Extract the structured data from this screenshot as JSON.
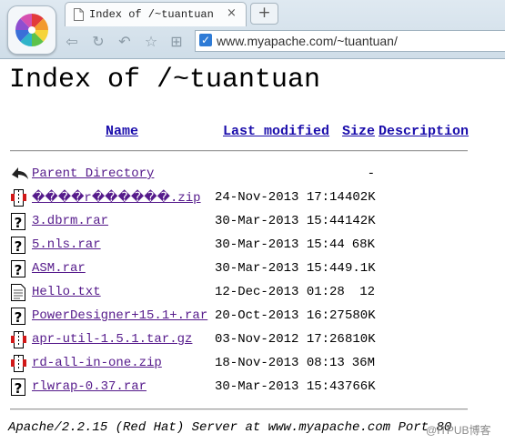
{
  "browser": {
    "tab_title": "Index of /~tuantuan",
    "tab_close": "×",
    "new_tab": "+",
    "url": "www.myapache.com/~tuantuan/"
  },
  "page": {
    "heading": "Index of /~tuantuan",
    "columns": {
      "name": "Name",
      "last_modified": "Last modified",
      "size": "Size",
      "description": "Description"
    },
    "parent": {
      "label": "Parent Directory",
      "size": "-"
    },
    "files": [
      {
        "name": "����r������.zip",
        "date": "24-Nov-2013 17:14",
        "size": "402K",
        "icon": "compressed-icon"
      },
      {
        "name": "3.dbrm.rar",
        "date": "30-Mar-2013 15:44",
        "size": "142K",
        "icon": "unknown-icon"
      },
      {
        "name": "5.nls.rar",
        "date": "30-Mar-2013 15:44",
        "size": "68K",
        "icon": "unknown-icon"
      },
      {
        "name": "ASM.rar",
        "date": "30-Mar-2013 15:44",
        "size": "9.1K",
        "icon": "unknown-icon"
      },
      {
        "name": "Hello.txt",
        "date": "12-Dec-2013 01:28",
        "size": "12",
        "icon": "text-file-icon"
      },
      {
        "name": "PowerDesigner+15.1+.rar",
        "date": "20-Oct-2013 16:27",
        "size": "580K",
        "icon": "unknown-icon"
      },
      {
        "name": "apr-util-1.5.1.tar.gz",
        "date": "03-Nov-2012 17:26",
        "size": "810K",
        "icon": "compressed-icon"
      },
      {
        "name": "rd-all-in-one.zip",
        "date": "18-Nov-2013 08:13",
        "size": "36M",
        "icon": "compressed-icon"
      },
      {
        "name": "rlwrap-0.37.rar",
        "date": "30-Mar-2013 15:43",
        "size": "766K",
        "icon": "unknown-icon"
      }
    ],
    "footer": "Apache/2.2.15 (Red Hat) Server at www.myapache.com Port 80"
  },
  "watermark": "@ITPUB博客"
}
